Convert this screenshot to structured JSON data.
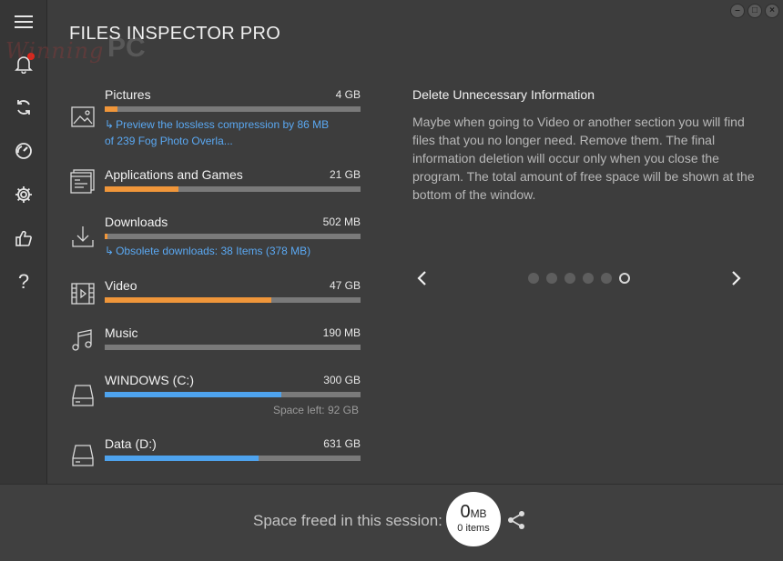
{
  "app": {
    "title": "FILES INSPECTOR PRO"
  },
  "watermark": {
    "script": "Winning",
    "pc": "PC"
  },
  "window_controls": [
    {
      "icon": "minimize-icon",
      "glyph": "–"
    },
    {
      "icon": "maximize-icon",
      "glyph": "□"
    },
    {
      "icon": "close-icon",
      "glyph": "×"
    }
  ],
  "sidebar": {
    "items": [
      {
        "icon": "menu-icon"
      },
      {
        "icon": "bell-icon",
        "notification": true,
        "notification_color": "#e0261b"
      },
      {
        "icon": "refresh-icon"
      },
      {
        "icon": "speedometer-icon"
      },
      {
        "icon": "gear-icon"
      },
      {
        "icon": "thumbs-up-icon"
      },
      {
        "icon": "help-icon",
        "glyph": "?"
      }
    ]
  },
  "categories": [
    {
      "icon": "image-icon",
      "name": "Pictures",
      "size": "4 GB",
      "fill": 0.05,
      "color": "orange",
      "sub": "Preview the lossless compression by 86 MB",
      "sub2": "of 239 Fog Photo Overla..."
    },
    {
      "icon": "applications-icon",
      "name": "Applications and Games",
      "size": "21 GB",
      "fill": 0.29,
      "color": "orange"
    },
    {
      "icon": "download-icon",
      "name": "Downloads",
      "size": "502 MB",
      "fill": 0.01,
      "color": "orange",
      "sub": "Obsolete downloads: 38 Items (378 MB)"
    },
    {
      "icon": "film-icon",
      "name": "Video",
      "size": "47 GB",
      "fill": 0.65,
      "color": "orange"
    },
    {
      "icon": "music-note-icon",
      "name": "Music",
      "size": "190 MB",
      "fill": 0.0,
      "color": "orange"
    },
    {
      "icon": "hard-drive-icon",
      "name": "WINDOWS (C:)",
      "size": "300 GB",
      "fill": 0.69,
      "color": "blue",
      "space_left": "Space left: 92 GB"
    },
    {
      "icon": "hard-drive-icon",
      "name": "Data (D:)",
      "size": "631 GB",
      "fill": 0.6,
      "color": "blue"
    }
  ],
  "info": {
    "title": "Delete Unnecessary Information",
    "text": "Maybe when going to Video or another section you will find files that you no longer need. Remove them. The final information deletion will occur only when you close the program. The total amount of free space will be shown at the bottom of the window.",
    "pager": {
      "count": 6,
      "active_index": 5
    }
  },
  "footer": {
    "label": "Space freed in this session:",
    "freed_value": "0",
    "freed_unit": "MB",
    "freed_items": "0 items"
  },
  "colors": {
    "orange": "#f0963a",
    "blue": "#4ea3ee",
    "link": "#5aa8f2"
  }
}
